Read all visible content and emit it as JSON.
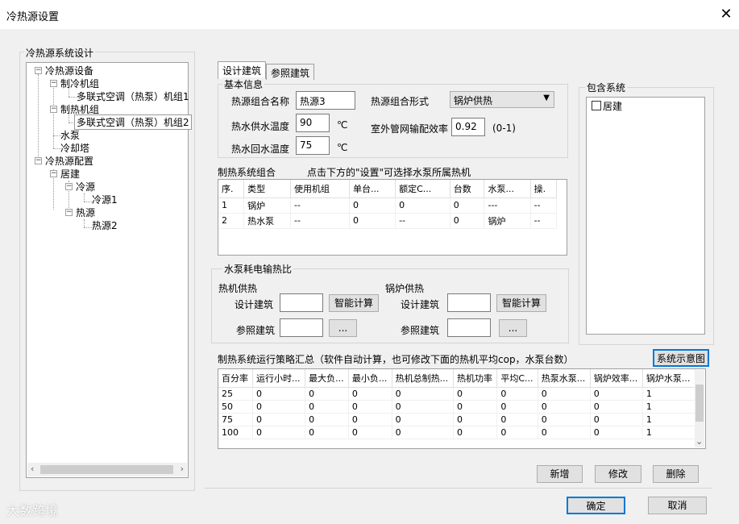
{
  "window": {
    "title": "冷热源设置",
    "close_glyph": "✕"
  },
  "left_panel": {
    "group_label": "冷热源系统设计",
    "tree": {
      "root1": "冷热源设备",
      "cooling_units": "制冷机组",
      "cooling_unit_item": "多联式空调（热泵）机组1",
      "heating_units": "制热机组",
      "heating_unit_item": "多联式空调（热泵）机组2",
      "pump": "水泵",
      "cooling_tower": "冷却塔",
      "root2": "冷热源配置",
      "building": "居建",
      "cold_source": "冷源",
      "cold_source_1": "冷源1",
      "heat_source": "热源",
      "heat_source_2": "热源2"
    }
  },
  "tabs": {
    "design": "设计建筑",
    "reference": "参照建筑"
  },
  "basic_info": {
    "label": "基本信息",
    "combo_name_label": "热源组合名称",
    "combo_name_value": "热源3",
    "combo_form_label": "热源组合形式",
    "combo_form_value": "锅炉供热",
    "supply_temp_label": "热水供水温度",
    "supply_temp_value": "90",
    "supply_temp_unit": "℃",
    "return_temp_label": "热水回水温度",
    "return_temp_value": "75",
    "return_temp_unit": "℃",
    "pipe_eff_label": "室外管网输配效率",
    "pipe_eff_value": "0.92",
    "pipe_eff_range": "(0-1)"
  },
  "heating_combo": {
    "label": "制热系统组合",
    "hint": "点击下方的\"设置\"可选择水泵所属热机",
    "columns": [
      "序.",
      "类型",
      "使用机组",
      "单台...",
      "额定C...",
      "台数",
      "水泵...",
      "操."
    ],
    "rows": [
      [
        "1",
        "锅炉",
        "--",
        "0",
        "0",
        "0",
        "---",
        "--"
      ],
      [
        "2",
        "热水泵",
        "--",
        "0",
        "--",
        "0",
        "锅炉",
        "--"
      ]
    ]
  },
  "pump_ratio": {
    "label": "水泵耗电输热比",
    "heat_machine_label": "热机供热",
    "boiler_label": "锅炉供热",
    "design_building": "设计建筑",
    "reference_building": "参照建筑",
    "smart_calc": "智能计算",
    "ellipsis": "...",
    "hm_design_value": "",
    "hm_ref_value": "",
    "boiler_design_value": "",
    "boiler_ref_value": ""
  },
  "include_system": {
    "label": "包含系统",
    "items": [
      {
        "label": "居建",
        "checked": false
      }
    ]
  },
  "strategy": {
    "label": "制热系统运行策略汇总（软件自动计算，也可修改下面的热机平均cop，水泵台数）",
    "diagram_button": "系统示意图",
    "columns": [
      "百分率",
      "运行小时...",
      "最大负...",
      "最小负...",
      "热机总制热...",
      "热机功率",
      "平均C...",
      "热泵水泵...",
      "锅炉效率...",
      "锅炉水泵..."
    ],
    "rows": [
      [
        "25",
        "0",
        "0",
        "0",
        "0",
        "0",
        "0",
        "0",
        "0",
        "1"
      ],
      [
        "50",
        "0",
        "0",
        "0",
        "0",
        "0",
        "0",
        "0",
        "0",
        "1"
      ],
      [
        "75",
        "0",
        "0",
        "0",
        "0",
        "0",
        "0",
        "0",
        "0",
        "1"
      ],
      [
        "100",
        "0",
        "0",
        "0",
        "0",
        "0",
        "0",
        "0",
        "0",
        "1"
      ]
    ]
  },
  "actions": {
    "add": "新增",
    "edit": "修改",
    "delete": "删除",
    "ok": "确定",
    "cancel": "取消"
  },
  "watermark": "大数跨境"
}
